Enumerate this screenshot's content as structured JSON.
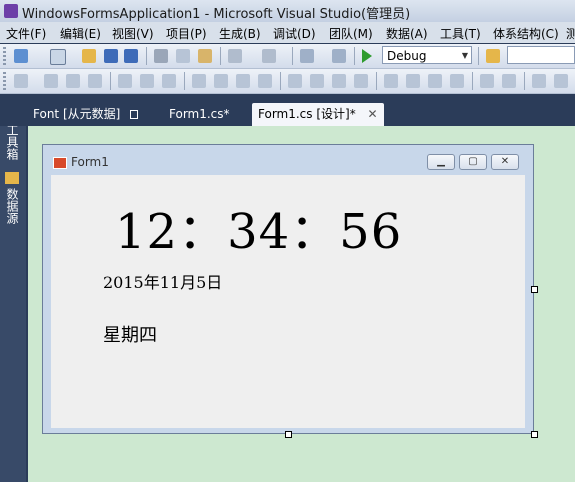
{
  "window": {
    "title": "WindowsFormsApplication1 - Microsoft Visual Studio(管理员)"
  },
  "menu": [
    "文件(F)",
    "编辑(E)",
    "视图(V)",
    "项目(P)",
    "生成(B)",
    "调试(D)",
    "团队(M)",
    "数据(A)",
    "工具(T)",
    "体系结构(C)",
    "测"
  ],
  "toolbar": {
    "config": "Debug"
  },
  "tabs": [
    {
      "label": "Font [从元数据]"
    },
    {
      "label": "Form1.cs*"
    },
    {
      "label": "Form1.cs [设计]*"
    }
  ],
  "side": {
    "toolbox": "工具箱",
    "datasource": "数据源"
  },
  "form": {
    "title": "Form1",
    "time": "12：34：56",
    "date": "2015年11月5日",
    "weekday": "星期四"
  }
}
